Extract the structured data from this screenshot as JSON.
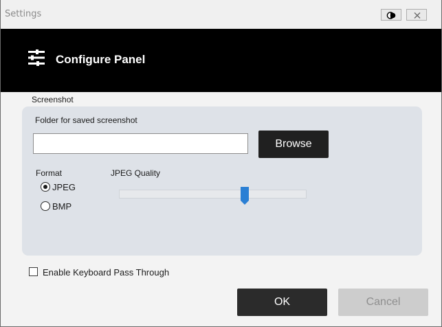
{
  "window": {
    "title": "Settings"
  },
  "titlebar": {
    "theme_button_icon": "theme-toggle-icon",
    "close_button_icon": "close-icon"
  },
  "header": {
    "title": "Configure Panel",
    "icon": "sliders-icon",
    "background": "#000000"
  },
  "screenshot": {
    "section_label": "Screenshot",
    "folder_label": "Folder for saved screenshot",
    "folder_value": "",
    "browse_label": "Browse",
    "format_label": "Format",
    "format_options": [
      {
        "label": "JPEG",
        "checked": true
      },
      {
        "label": "BMP",
        "checked": false
      }
    ],
    "quality_label": "JPEG Quality",
    "quality_level": 0.68,
    "accent": "#2a7fd4"
  },
  "keyboard_pass_through": {
    "label": "Enable Keyboard Pass Through",
    "checked": false
  },
  "footer": {
    "ok_label": "OK",
    "cancel_label": "Cancel"
  }
}
